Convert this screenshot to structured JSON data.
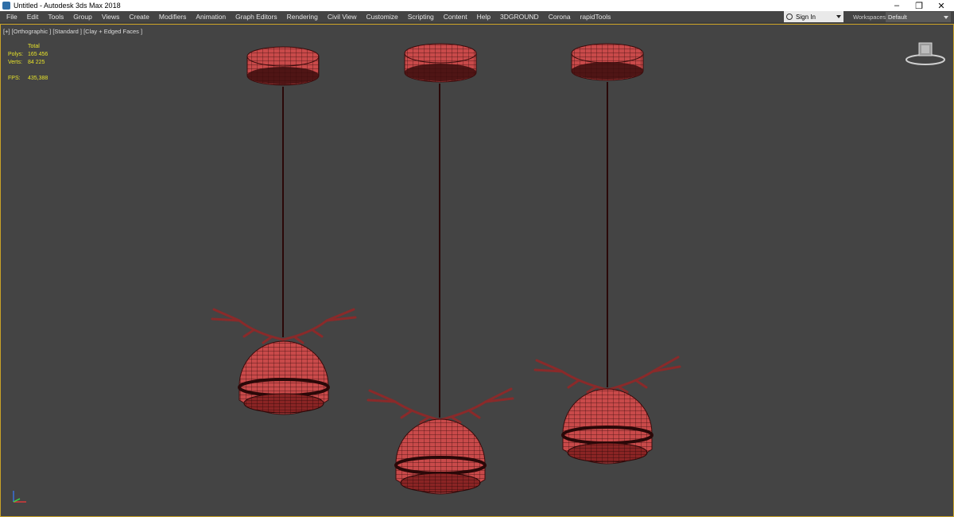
{
  "window": {
    "title": "Untitled - Autodesk 3ds Max 2018",
    "controls": [
      "–",
      "❐",
      "✕"
    ]
  },
  "menu": {
    "items": [
      "File",
      "Edit",
      "Tools",
      "Group",
      "Views",
      "Create",
      "Modifiers",
      "Animation",
      "Graph Editors",
      "Rendering",
      "Civil View",
      "Customize",
      "Scripting",
      "Content",
      "Help",
      "3DGROUND",
      "Corona",
      "rapidTools"
    ],
    "sign_in": "Sign In",
    "workspaces_label": "Workspaces:",
    "workspaces_value": "Default"
  },
  "viewport": {
    "label": "[+] [Orthographic ] [Standard ] [Clay + Edged Faces ]",
    "stats": {
      "total_label": "Total",
      "polys_label": "Polys:",
      "polys_value": "165 456",
      "verts_label": "Verts:",
      "verts_value": "84 225",
      "fps_label": "FPS:",
      "fps_value": "435,388"
    }
  },
  "colors": {
    "viewport_bg": "#444444",
    "model_fill": "#c94a4a",
    "model_wire": "#3a0c0c",
    "active_border": "#c9a227",
    "stats_text": "#e6e22a"
  },
  "icons": {
    "app": "3dsmax-app-icon",
    "user": "user-icon",
    "viewcube": "viewcube-icon",
    "axis": "axis-tripod-icon"
  }
}
